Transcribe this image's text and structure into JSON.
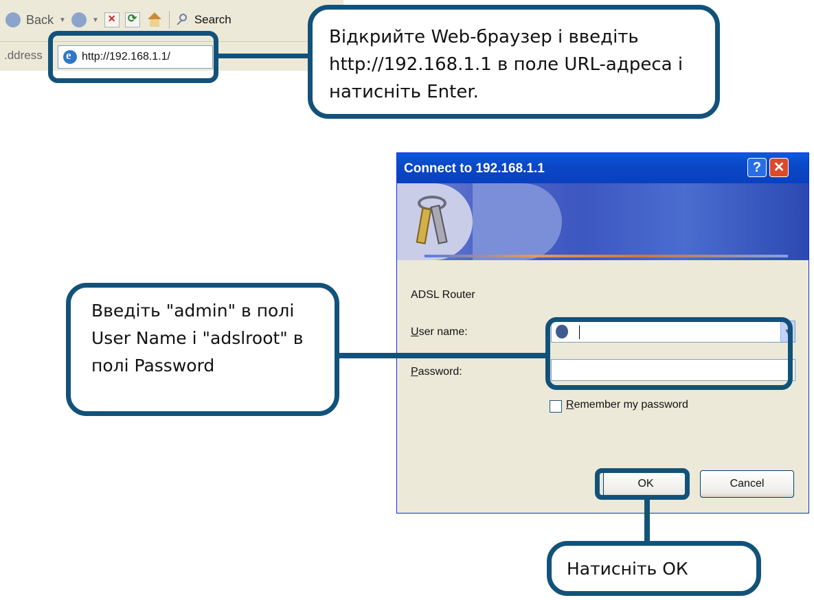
{
  "browser": {
    "back_label": "Back",
    "search_label": "Search",
    "address_label": ".ddress",
    "url": "http://192.168.1.1/"
  },
  "dialog": {
    "title": "Connect to 192.168.1.1",
    "help_symbol": "?",
    "close_symbol": "✕",
    "realm": "ADSL Router",
    "user_label_u": "U",
    "user_label_rest": "ser name:",
    "pass_label_p": "P",
    "pass_label_rest": "assword:",
    "username_value": "",
    "password_value": "",
    "remember_label_r": "R",
    "remember_label_rest": "emember my password",
    "remember_checked": false,
    "ok_label": "OK",
    "cancel_label": "Cancel"
  },
  "callouts": {
    "top": "Відкрийте Web-браузер і введіть http://192.168.1.1 в поле URL-адреса і натисніть Enter.",
    "left": "Введіть \"admin\" в полі User Name і \"adslroot\" в полі Password",
    "bottom": "Натисніть ОК"
  },
  "colors": {
    "callout_border": "#12527a",
    "title_bar": "#0a48c7",
    "dialog_bg": "#ece9d8"
  }
}
